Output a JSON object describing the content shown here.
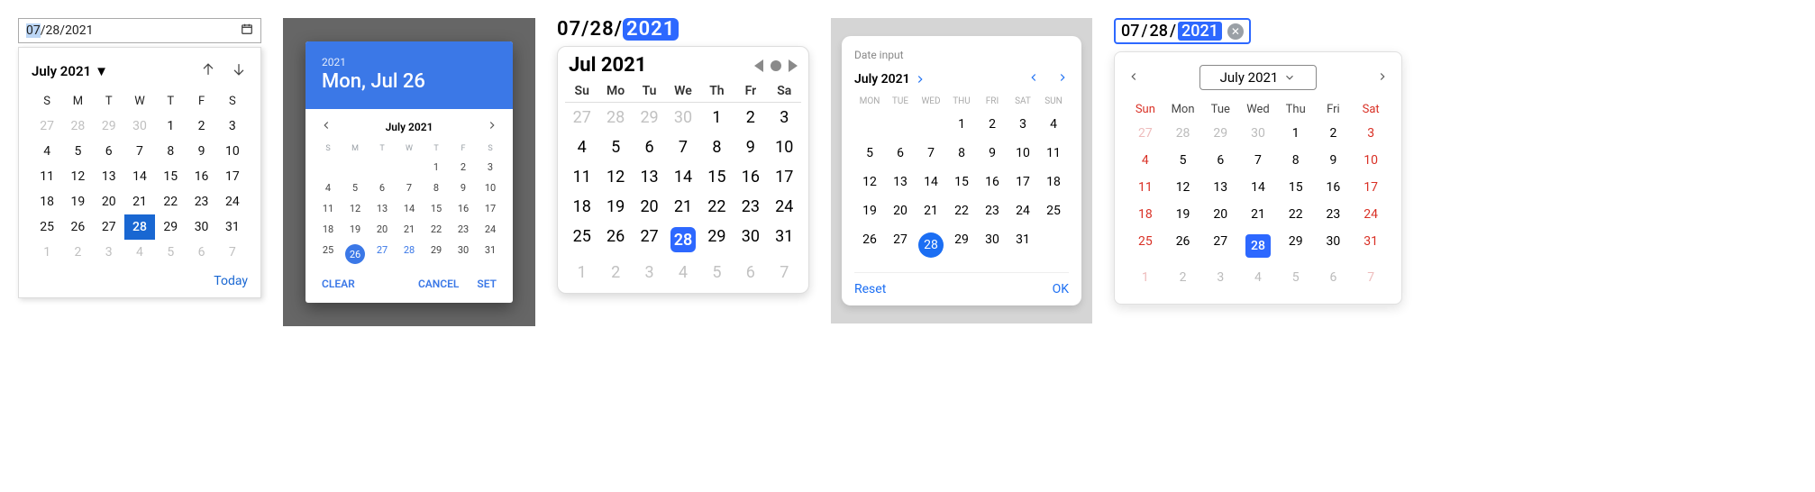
{
  "chrome": {
    "input": {
      "mm": "07",
      "sep": "/",
      "dd": "28",
      "yyyy": "2021"
    },
    "month_label": "July 2021",
    "today_label": "Today",
    "weekdays": [
      "S",
      "M",
      "T",
      "W",
      "T",
      "F",
      "S"
    ],
    "grid": [
      [
        {
          "n": "27",
          "out": true
        },
        {
          "n": "28",
          "out": true
        },
        {
          "n": "29",
          "out": true
        },
        {
          "n": "30",
          "out": true
        },
        {
          "n": "1"
        },
        {
          "n": "2"
        },
        {
          "n": "3"
        }
      ],
      [
        {
          "n": "4"
        },
        {
          "n": "5"
        },
        {
          "n": "6"
        },
        {
          "n": "7"
        },
        {
          "n": "8"
        },
        {
          "n": "9"
        },
        {
          "n": "10"
        }
      ],
      [
        {
          "n": "11"
        },
        {
          "n": "12"
        },
        {
          "n": "13"
        },
        {
          "n": "14"
        },
        {
          "n": "15"
        },
        {
          "n": "16"
        },
        {
          "n": "17"
        }
      ],
      [
        {
          "n": "18"
        },
        {
          "n": "19"
        },
        {
          "n": "20"
        },
        {
          "n": "21"
        },
        {
          "n": "22"
        },
        {
          "n": "23"
        },
        {
          "n": "24"
        }
      ],
      [
        {
          "n": "25"
        },
        {
          "n": "26"
        },
        {
          "n": "27"
        },
        {
          "n": "28",
          "sel": true
        },
        {
          "n": "29"
        },
        {
          "n": "30"
        },
        {
          "n": "31"
        }
      ],
      [
        {
          "n": "1",
          "out": true
        },
        {
          "n": "2",
          "out": true
        },
        {
          "n": "3",
          "out": true
        },
        {
          "n": "4",
          "out": true
        },
        {
          "n": "5",
          "out": true
        },
        {
          "n": "6",
          "out": true
        },
        {
          "n": "7",
          "out": true
        }
      ]
    ]
  },
  "android": {
    "year": "2021",
    "date_text": "Mon, Jul 26",
    "month_label": "July 2021",
    "actions": {
      "clear": "CLEAR",
      "cancel": "CANCEL",
      "set": "SET"
    },
    "weekdays": [
      "S",
      "M",
      "T",
      "W",
      "T",
      "F",
      "S"
    ],
    "grid": [
      [
        {
          "n": ""
        },
        {
          "n": ""
        },
        {
          "n": ""
        },
        {
          "n": ""
        },
        {
          "n": "1"
        },
        {
          "n": "2"
        },
        {
          "n": "3"
        }
      ],
      [
        {
          "n": "4"
        },
        {
          "n": "5"
        },
        {
          "n": "6"
        },
        {
          "n": "7"
        },
        {
          "n": "8"
        },
        {
          "n": "9"
        },
        {
          "n": "10"
        }
      ],
      [
        {
          "n": "11"
        },
        {
          "n": "12"
        },
        {
          "n": "13"
        },
        {
          "n": "14"
        },
        {
          "n": "15"
        },
        {
          "n": "16"
        },
        {
          "n": "17"
        }
      ],
      [
        {
          "n": "18"
        },
        {
          "n": "19"
        },
        {
          "n": "20"
        },
        {
          "n": "21"
        },
        {
          "n": "22"
        },
        {
          "n": "23"
        },
        {
          "n": "24"
        }
      ],
      [
        {
          "n": "25"
        },
        {
          "n": "26",
          "sel": true
        },
        {
          "n": "27",
          "blue": true
        },
        {
          "n": "28",
          "blue": true
        },
        {
          "n": "29"
        },
        {
          "n": "30"
        },
        {
          "n": "31"
        }
      ]
    ]
  },
  "ios": {
    "input": {
      "mm": "07",
      "dd": "28",
      "yyyy": "2021",
      "sep": "/"
    },
    "month_label": "Jul 2021",
    "weekdays": [
      "Su",
      "Mo",
      "Tu",
      "We",
      "Th",
      "Fr",
      "Sa"
    ],
    "grid": [
      [
        {
          "n": "27",
          "out": true
        },
        {
          "n": "28",
          "out": true
        },
        {
          "n": "29",
          "out": true
        },
        {
          "n": "30",
          "out": true
        },
        {
          "n": "1"
        },
        {
          "n": "2"
        },
        {
          "n": "3"
        }
      ],
      [
        {
          "n": "4"
        },
        {
          "n": "5"
        },
        {
          "n": "6"
        },
        {
          "n": "7"
        },
        {
          "n": "8"
        },
        {
          "n": "9"
        },
        {
          "n": "10"
        }
      ],
      [
        {
          "n": "11"
        },
        {
          "n": "12"
        },
        {
          "n": "13"
        },
        {
          "n": "14"
        },
        {
          "n": "15"
        },
        {
          "n": "16"
        },
        {
          "n": "17"
        }
      ],
      [
        {
          "n": "18"
        },
        {
          "n": "19"
        },
        {
          "n": "20"
        },
        {
          "n": "21"
        },
        {
          "n": "22"
        },
        {
          "n": "23"
        },
        {
          "n": "24"
        }
      ],
      [
        {
          "n": "25"
        },
        {
          "n": "26"
        },
        {
          "n": "27"
        },
        {
          "n": "28",
          "sel": true
        },
        {
          "n": "29"
        },
        {
          "n": "30"
        },
        {
          "n": "31"
        }
      ],
      [
        {
          "n": "1",
          "out": true
        },
        {
          "n": "2",
          "out": true
        },
        {
          "n": "3",
          "out": true
        },
        {
          "n": "4",
          "out": true
        },
        {
          "n": "5",
          "out": true
        },
        {
          "n": "6",
          "out": true
        },
        {
          "n": "7",
          "out": true
        }
      ]
    ]
  },
  "fluent": {
    "label": "Date input",
    "month_label": "July 2021",
    "actions": {
      "reset": "Reset",
      "ok": "OK"
    },
    "weekdays": [
      "MON",
      "TUE",
      "WED",
      "THU",
      "FRI",
      "SAT",
      "SUN"
    ],
    "grid": [
      [
        {
          "n": ""
        },
        {
          "n": ""
        },
        {
          "n": ""
        },
        {
          "n": "1"
        },
        {
          "n": "2"
        },
        {
          "n": "3"
        },
        {
          "n": "4"
        }
      ],
      [
        {
          "n": "5"
        },
        {
          "n": "6"
        },
        {
          "n": "7"
        },
        {
          "n": "8"
        },
        {
          "n": "9"
        },
        {
          "n": "10"
        },
        {
          "n": "11"
        }
      ],
      [
        {
          "n": "12"
        },
        {
          "n": "13"
        },
        {
          "n": "14"
        },
        {
          "n": "15"
        },
        {
          "n": "16"
        },
        {
          "n": "17"
        },
        {
          "n": "18"
        }
      ],
      [
        {
          "n": "19"
        },
        {
          "n": "20"
        },
        {
          "n": "21"
        },
        {
          "n": "22"
        },
        {
          "n": "23"
        },
        {
          "n": "24"
        },
        {
          "n": "25"
        }
      ],
      [
        {
          "n": "26"
        },
        {
          "n": "27"
        },
        {
          "n": "28",
          "sel": true
        },
        {
          "n": "29"
        },
        {
          "n": "30"
        },
        {
          "n": "31"
        },
        {
          "n": ""
        }
      ]
    ]
  },
  "wc": {
    "input": {
      "mm": "07",
      "dd": "28",
      "yyyy": "2021",
      "sep": " / "
    },
    "month_label": "July 2021",
    "weekdays": [
      "Sun",
      "Mon",
      "Tue",
      "Wed",
      "Thu",
      "Fri",
      "Sat"
    ],
    "grid": [
      [
        {
          "n": "27",
          "out": true,
          "we": true
        },
        {
          "n": "28",
          "out": true
        },
        {
          "n": "29",
          "out": true
        },
        {
          "n": "30",
          "out": true
        },
        {
          "n": "1"
        },
        {
          "n": "2"
        },
        {
          "n": "3",
          "we": true
        }
      ],
      [
        {
          "n": "4",
          "we": true
        },
        {
          "n": "5"
        },
        {
          "n": "6"
        },
        {
          "n": "7"
        },
        {
          "n": "8"
        },
        {
          "n": "9"
        },
        {
          "n": "10",
          "we": true
        }
      ],
      [
        {
          "n": "11",
          "we": true
        },
        {
          "n": "12"
        },
        {
          "n": "13"
        },
        {
          "n": "14"
        },
        {
          "n": "15"
        },
        {
          "n": "16"
        },
        {
          "n": "17",
          "we": true
        }
      ],
      [
        {
          "n": "18",
          "we": true
        },
        {
          "n": "19"
        },
        {
          "n": "20"
        },
        {
          "n": "21"
        },
        {
          "n": "22"
        },
        {
          "n": "23"
        },
        {
          "n": "24",
          "we": true
        }
      ],
      [
        {
          "n": "25",
          "we": true
        },
        {
          "n": "26"
        },
        {
          "n": "27"
        },
        {
          "n": "28",
          "sel": true
        },
        {
          "n": "29"
        },
        {
          "n": "30"
        },
        {
          "n": "31",
          "we": true
        }
      ],
      [
        {
          "n": "1",
          "out": true,
          "we": true
        },
        {
          "n": "2",
          "out": true
        },
        {
          "n": "3",
          "out": true
        },
        {
          "n": "4",
          "out": true
        },
        {
          "n": "5",
          "out": true
        },
        {
          "n": "6",
          "out": true
        },
        {
          "n": "7",
          "out": true,
          "we": true
        }
      ]
    ]
  }
}
